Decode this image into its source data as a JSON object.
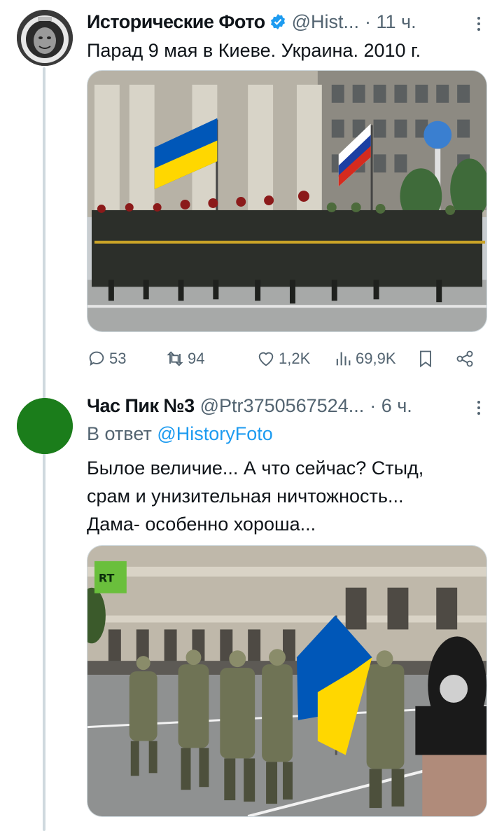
{
  "tweets": [
    {
      "display_name": "Исторические Фото",
      "handle": "@Hist...",
      "time": "· 11 ч.",
      "text": "Парад 9 мая в Киеве. Украина. 2010 г.",
      "avatar_icon": "cosmonaut-avatar",
      "verified": true,
      "media_description_icon": "parade-photo",
      "stats": {
        "replies": "53",
        "retweets": "94",
        "likes": "1,2K",
        "views": "69,9K"
      }
    },
    {
      "display_name": "Час Пик №3",
      "handle": "@Ptr3750567524...",
      "time": "· 6 ч.",
      "reply_prefix": "В ответ",
      "reply_mention": "@HistoryFoto",
      "text_lines": [
        "Былое величие... А что сейчас? Стыд,",
        "срам и унизительная ничтожность...",
        "Дама- особенно хороша..."
      ],
      "avatar_color": "#1b7d1b",
      "video_logo": "RT"
    }
  ],
  "colors": {
    "accent": "#1d9bf0",
    "secondary_text": "#536471",
    "thread_line": "#cfd9de",
    "flag_blue": "#0057b8",
    "flag_yellow": "#ffd700"
  }
}
